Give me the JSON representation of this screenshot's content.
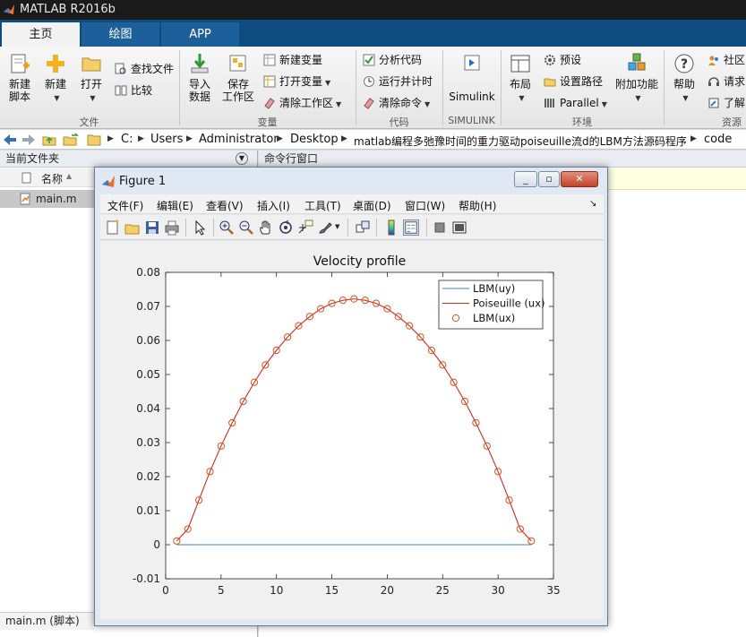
{
  "app": {
    "title": "MATLAB R2016b"
  },
  "tabs": [
    {
      "label": "主页"
    },
    {
      "label": "绘图"
    },
    {
      "label": "APP"
    }
  ],
  "ribbon": {
    "new_script": "新建\n脚本",
    "new": "新建",
    "open": "打开",
    "find_files": "查找文件",
    "compare": "比较",
    "import_data": "导入\n数据",
    "save_workspace": "保存\n工作区",
    "new_variable": "新建变量",
    "open_variable": "打开变量",
    "clear_workspace": "清除工作区",
    "analyze_code": "分析代码",
    "run_and_time": "运行并计时",
    "clear_commands": "清除命令",
    "simulink": "Simulink",
    "layout": "布局",
    "preferences": "预设",
    "set_path": "设置路径",
    "parallel": "Parallel",
    "addons": "附加功能",
    "help": "帮助",
    "community": "社区",
    "request": "请求",
    "learn": "了解",
    "groups": {
      "file": "文件",
      "variable": "变量",
      "code": "代码",
      "simulink": "SIMULINK",
      "environment": "环境",
      "resources": "资源"
    }
  },
  "address": {
    "segments": [
      "C:",
      "Users",
      "Administrator",
      "Desktop",
      "matlab编程多弛豫时间的重力驱动poiseuille流d的LBM方法源码程序",
      "code"
    ]
  },
  "current_folder": {
    "title": "当前文件夹",
    "column_name": "名称",
    "files": [
      {
        "name": "main.m"
      }
    ],
    "status": "main.m  (脚本)"
  },
  "command_window": {
    "title": "命令行窗口"
  },
  "figure": {
    "title": "Figure 1",
    "menu": [
      "文件(F)",
      "编辑(E)",
      "查看(V)",
      "插入(I)",
      "工具(T)",
      "桌面(D)",
      "窗口(W)",
      "帮助(H)"
    ]
  },
  "chart_data": {
    "type": "line",
    "title": "Velocity profile",
    "xlabel": "",
    "ylabel": "",
    "xlim": [
      0,
      35
    ],
    "ylim": [
      -0.01,
      0.08
    ],
    "xticks": [
      0,
      5,
      10,
      15,
      20,
      25,
      30,
      35
    ],
    "yticks": [
      -0.01,
      0,
      0.01,
      0.02,
      0.03,
      0.04,
      0.05,
      0.06,
      0.07,
      0.08
    ],
    "ytick_labels": [
      "-0.01",
      "0",
      "0.01",
      "0.02",
      "0.03",
      "0.04",
      "0.05",
      "0.06",
      "0.07",
      "0.08"
    ],
    "legend_position": "top-right",
    "grid": false,
    "series": [
      {
        "name": "LBM(uy)",
        "style": "line",
        "color": "#3d86c6",
        "x": [
          1,
          33
        ],
        "y": [
          0,
          0
        ]
      },
      {
        "name": "Poiseuille (ux)",
        "style": "line",
        "color": "#d32a1e",
        "x": [
          1,
          2,
          3,
          4,
          5,
          6,
          7,
          8,
          9,
          10,
          11,
          12,
          13,
          14,
          15,
          16,
          17,
          18,
          19,
          20,
          21,
          22,
          23,
          24,
          25,
          26,
          27,
          28,
          29,
          30,
          31,
          32,
          33
        ],
        "y": [
          0.0011,
          0.0046,
          0.0131,
          0.0215,
          0.029,
          0.0358,
          0.0421,
          0.0477,
          0.0528,
          0.0571,
          0.061,
          0.0643,
          0.067,
          0.0693,
          0.0709,
          0.0718,
          0.0722,
          0.0718,
          0.0709,
          0.0693,
          0.067,
          0.0643,
          0.061,
          0.0571,
          0.0528,
          0.0477,
          0.0421,
          0.0358,
          0.029,
          0.0215,
          0.0131,
          0.0046,
          0.0011
        ]
      },
      {
        "name": "LBM(ux)",
        "style": "marker",
        "color": "#d9531e",
        "x": [
          1,
          2,
          3,
          4,
          5,
          6,
          7,
          8,
          9,
          10,
          11,
          12,
          13,
          14,
          15,
          16,
          17,
          18,
          19,
          20,
          21,
          22,
          23,
          24,
          25,
          26,
          27,
          28,
          29,
          30,
          31,
          32,
          33
        ],
        "y": [
          0.0011,
          0.0046,
          0.0131,
          0.0215,
          0.029,
          0.0358,
          0.0421,
          0.0477,
          0.0528,
          0.0571,
          0.061,
          0.0643,
          0.067,
          0.0693,
          0.0709,
          0.0718,
          0.0722,
          0.0718,
          0.0709,
          0.0693,
          0.067,
          0.0643,
          0.061,
          0.0571,
          0.0528,
          0.0477,
          0.0421,
          0.0358,
          0.029,
          0.0215,
          0.0131,
          0.0046,
          0.0011
        ]
      }
    ]
  }
}
